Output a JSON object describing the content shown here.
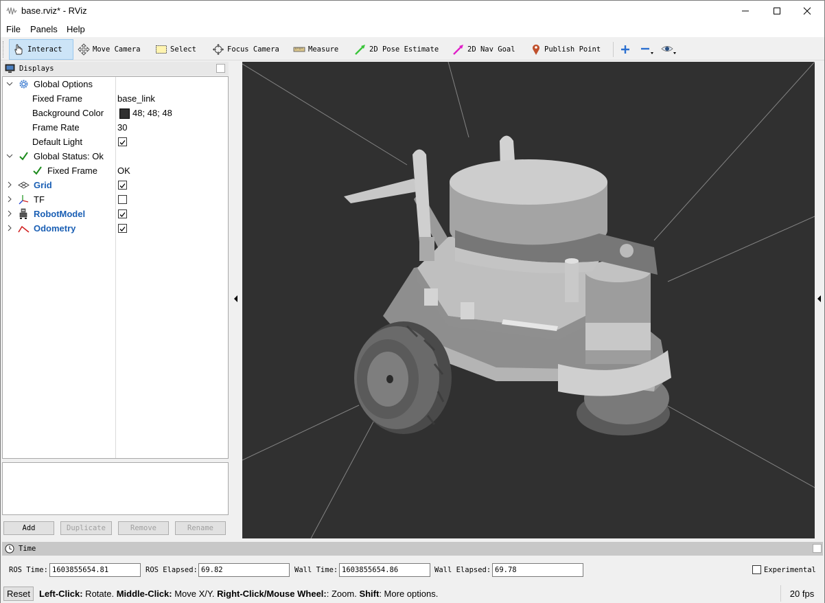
{
  "window": {
    "title": "base.rviz* - RViz"
  },
  "menu": [
    "File",
    "Panels",
    "Help"
  ],
  "toolbar": {
    "interact": "Interact",
    "move_camera": "Move Camera",
    "select": "Select",
    "focus_camera": "Focus Camera",
    "measure": "Measure",
    "pose_estimate": "2D Pose Estimate",
    "nav_goal": "2D Nav Goal",
    "publish_point": "Publish Point"
  },
  "displays": {
    "title": "Displays",
    "global_options": "Global Options",
    "fixed_frame_label": "Fixed Frame",
    "fixed_frame_value": "base_link",
    "bg_color_label": "Background Color",
    "bg_color_value": "48; 48; 48",
    "bg_color_hex": "#303030",
    "frame_rate_label": "Frame Rate",
    "frame_rate_value": "30",
    "default_light_label": "Default Light",
    "default_light_checked": true,
    "global_status": "Global Status: Ok",
    "status_fixed_frame_label": "Fixed Frame",
    "status_fixed_frame_value": "OK",
    "grid": "Grid",
    "grid_checked": true,
    "tf": "TF",
    "tf_checked": false,
    "robot_model": "RobotModel",
    "robot_model_checked": true,
    "odometry": "Odometry",
    "odometry_checked": true,
    "buttons": {
      "add": "Add",
      "duplicate": "Duplicate",
      "remove": "Remove",
      "rename": "Rename"
    }
  },
  "time": {
    "title": "Time",
    "ros_time_label": "ROS Time:",
    "ros_time": "1603855654.81",
    "ros_elapsed_label": "ROS Elapsed:",
    "ros_elapsed": "69.82",
    "wall_time_label": "Wall Time:",
    "wall_time": "1603855654.86",
    "wall_elapsed_label": "Wall Elapsed:",
    "wall_elapsed": "69.78",
    "experimental": "Experimental"
  },
  "status": {
    "reset": "Reset",
    "hint_left_key": "Left-Click:",
    "hint_left": " Rotate. ",
    "hint_middle_key": "Middle-Click:",
    "hint_middle": " Move X/Y. ",
    "hint_right_key": "Right-Click/Mouse Wheel:",
    "hint_right": ": Zoom. ",
    "hint_shift_key": "Shift",
    "hint_shift": ": More options.",
    "fps": "20 fps"
  }
}
